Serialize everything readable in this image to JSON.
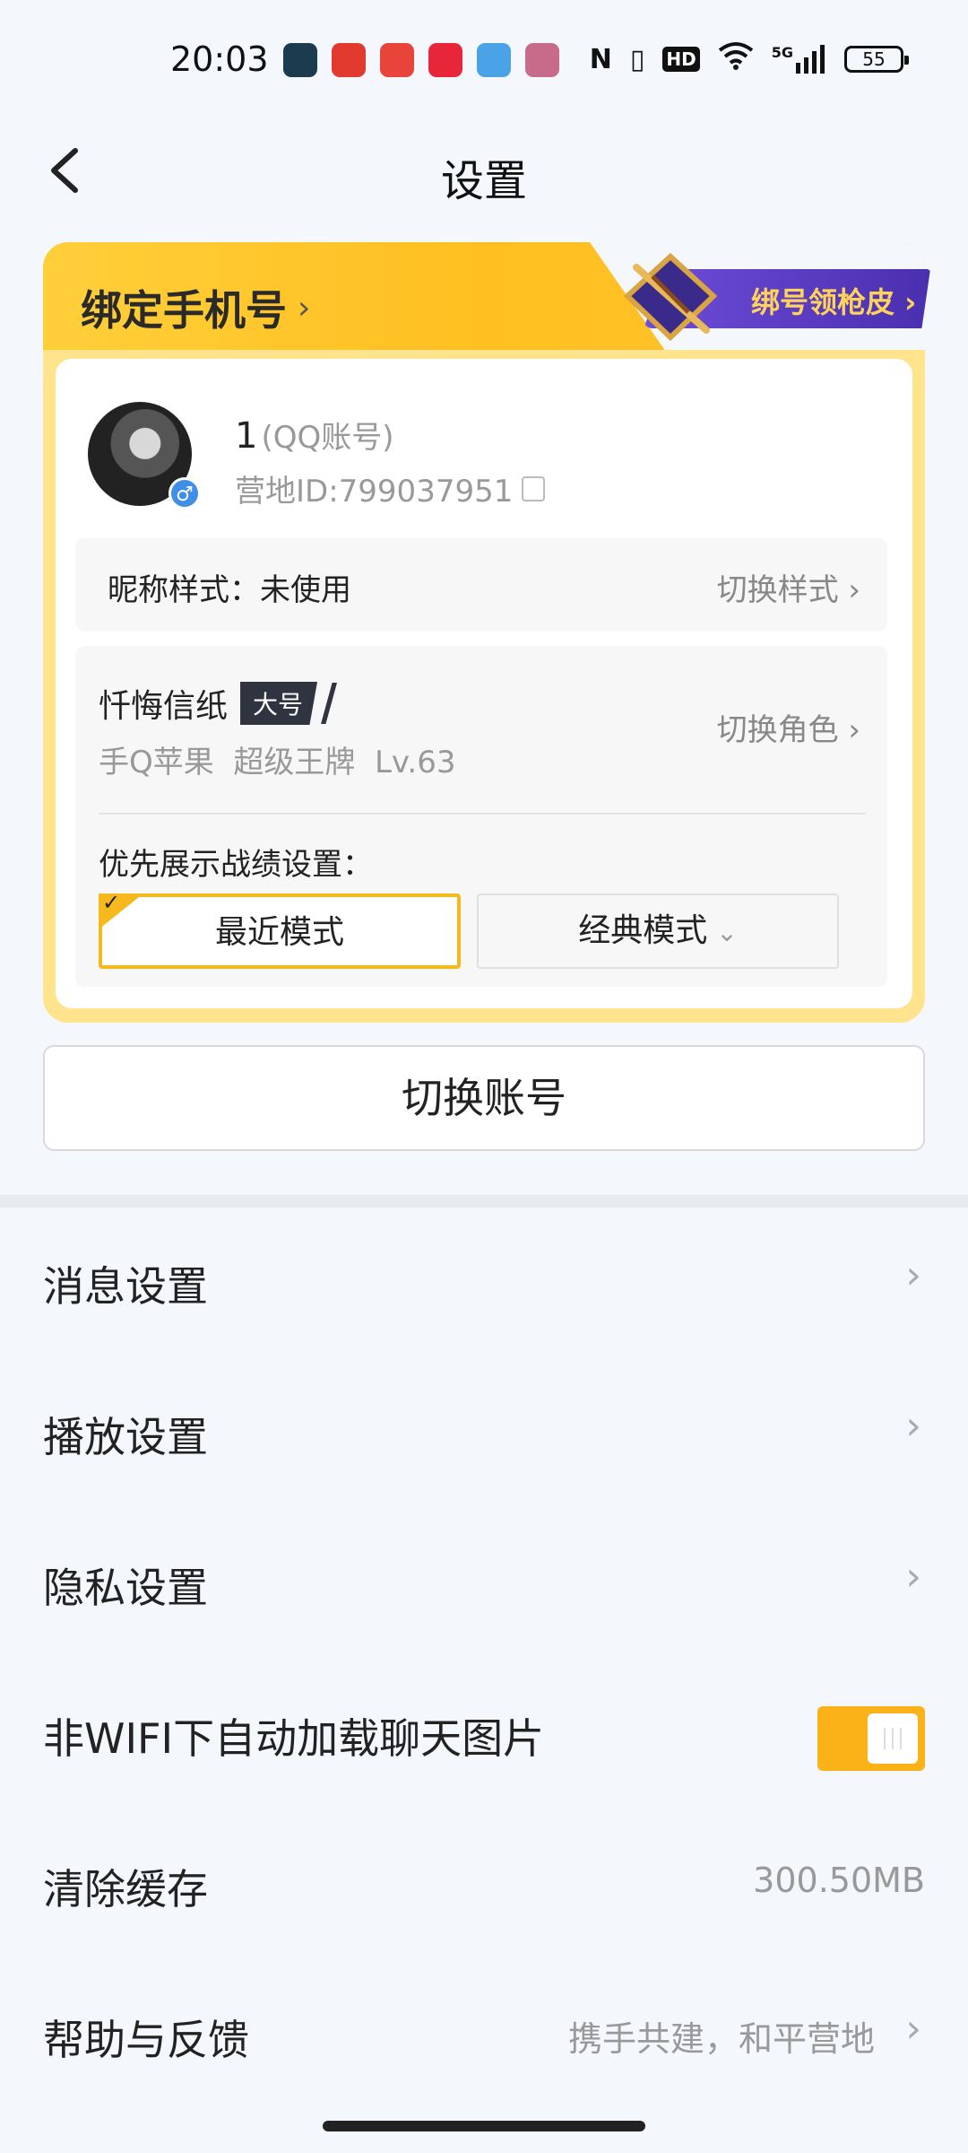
{
  "status_bar": {
    "time": "20:03",
    "network": "5G",
    "hd": "HD",
    "battery": "55",
    "app_icon_colors": [
      "#1d3b4f",
      "#e23a2f",
      "#e8443a",
      "#e8263a",
      "#4aa3e6",
      "#c86a8a"
    ]
  },
  "header": {
    "title": "设置",
    "back_icon": "back-chevron-icon"
  },
  "card": {
    "bind_phone": "绑定手机号",
    "promo": "绑号领枪皮",
    "account_name": "1",
    "account_type": "(QQ账号)",
    "camp_id": "营地ID:799037951",
    "gender_symbol": "♂",
    "nickname_style_label": "昵称样式：未使用",
    "switch_style": "切换样式",
    "role_name": "忏悔信纸",
    "role_badge": "大号",
    "role_detail": "手Q苹果  超级王牌  Lv.63",
    "switch_role": "切换角色",
    "priority_label": "优先展示战绩设置：",
    "mode_recent": "最近模式",
    "mode_classic": "经典模式",
    "accent_color": "#f5b91e"
  },
  "switch_account": "切换账号",
  "settings": {
    "message": "消息设置",
    "playback": "播放设置",
    "privacy": "隐私设置",
    "wifi_images": "非WIFI下自动加载聊天图片",
    "wifi_images_enabled": true,
    "clear_cache": "清除缓存",
    "cache_size": "300.50MB",
    "help": "帮助与反馈",
    "help_value": "携手共建，和平营地"
  }
}
